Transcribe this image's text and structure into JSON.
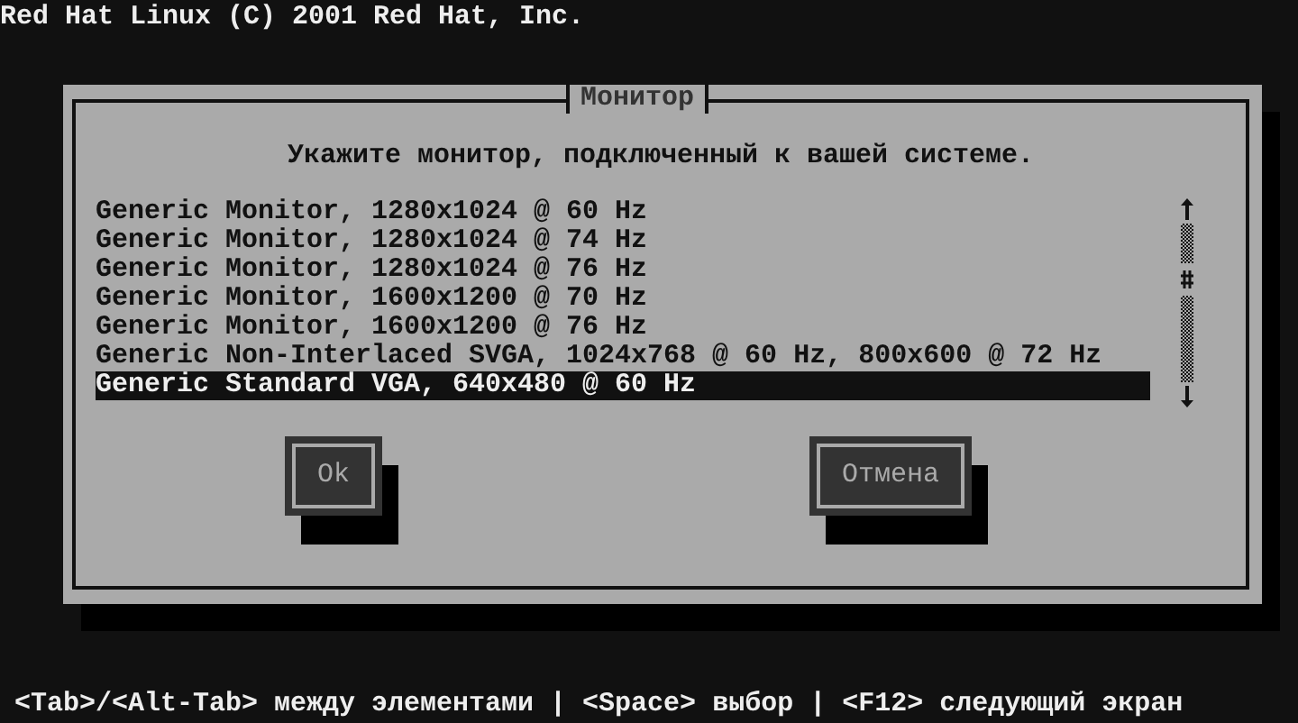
{
  "header": "Red Hat Linux (C) 2001 Red Hat, Inc.",
  "dialog": {
    "title": "Монитор",
    "prompt": "Укажите монитор, подключенный к вашей системе.",
    "items": [
      {
        "label": "Generic Monitor, 1280x1024 @ 60 Hz",
        "selected": false
      },
      {
        "label": "Generic Monitor, 1280x1024 @ 74 Hz",
        "selected": false
      },
      {
        "label": "Generic Monitor, 1280x1024 @ 76 Hz",
        "selected": false
      },
      {
        "label": "Generic Monitor, 1600x1200 @ 70 Hz",
        "selected": false
      },
      {
        "label": "Generic Monitor, 1600x1200 @ 76 Hz",
        "selected": false
      },
      {
        "label": "Generic Non-Interlaced SVGA, 1024x768 @ 60 Hz, 800x600 @ 72 Hz",
        "selected": false
      },
      {
        "label": "Generic Standard VGA, 640x480 @ 60 Hz",
        "selected": true
      }
    ],
    "buttons": [
      "Ok",
      "Отмена"
    ]
  },
  "status_bar": "<Tab>/<Alt-Tab> между элементами | <Space> выбор | <F12> следующий экран"
}
